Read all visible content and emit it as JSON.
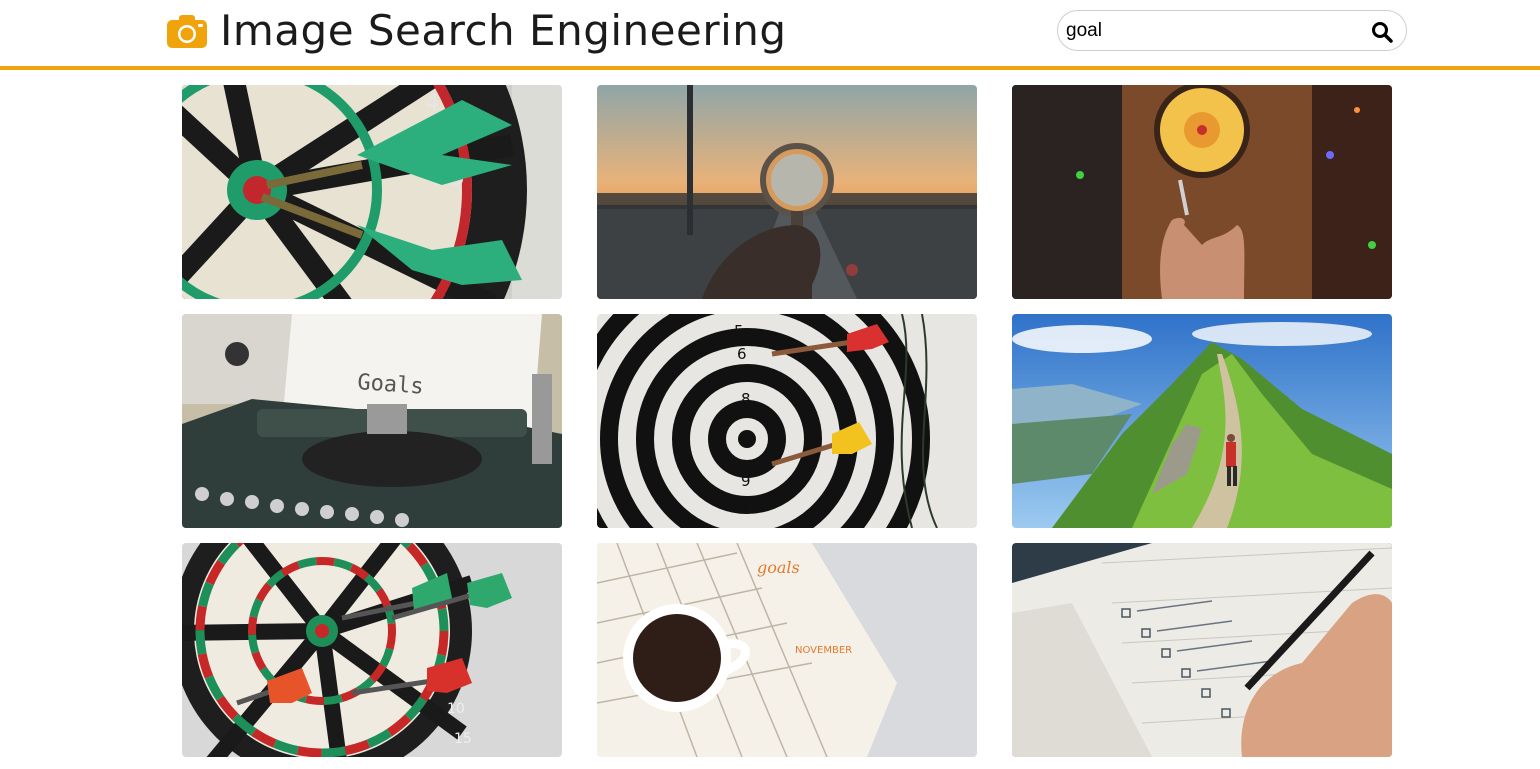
{
  "header": {
    "title": "Image Search Engineering",
    "logo_icon": "camera-icon",
    "accent_color": "#f0a30a"
  },
  "search": {
    "query": "goal",
    "button_icon": "search-icon"
  },
  "results": [
    {
      "subject": "dartboard-green-darts"
    },
    {
      "subject": "magnifying-glass-sunset"
    },
    {
      "subject": "hand-throwing-dart-bar"
    },
    {
      "subject": "typewriter-goals"
    },
    {
      "subject": "black-white-target-darts"
    },
    {
      "subject": "hiker-mountain-ridge"
    },
    {
      "subject": "dartboard-red-green-darts"
    },
    {
      "subject": "planner-coffee-cup"
    },
    {
      "subject": "hand-writing-checklist"
    }
  ]
}
